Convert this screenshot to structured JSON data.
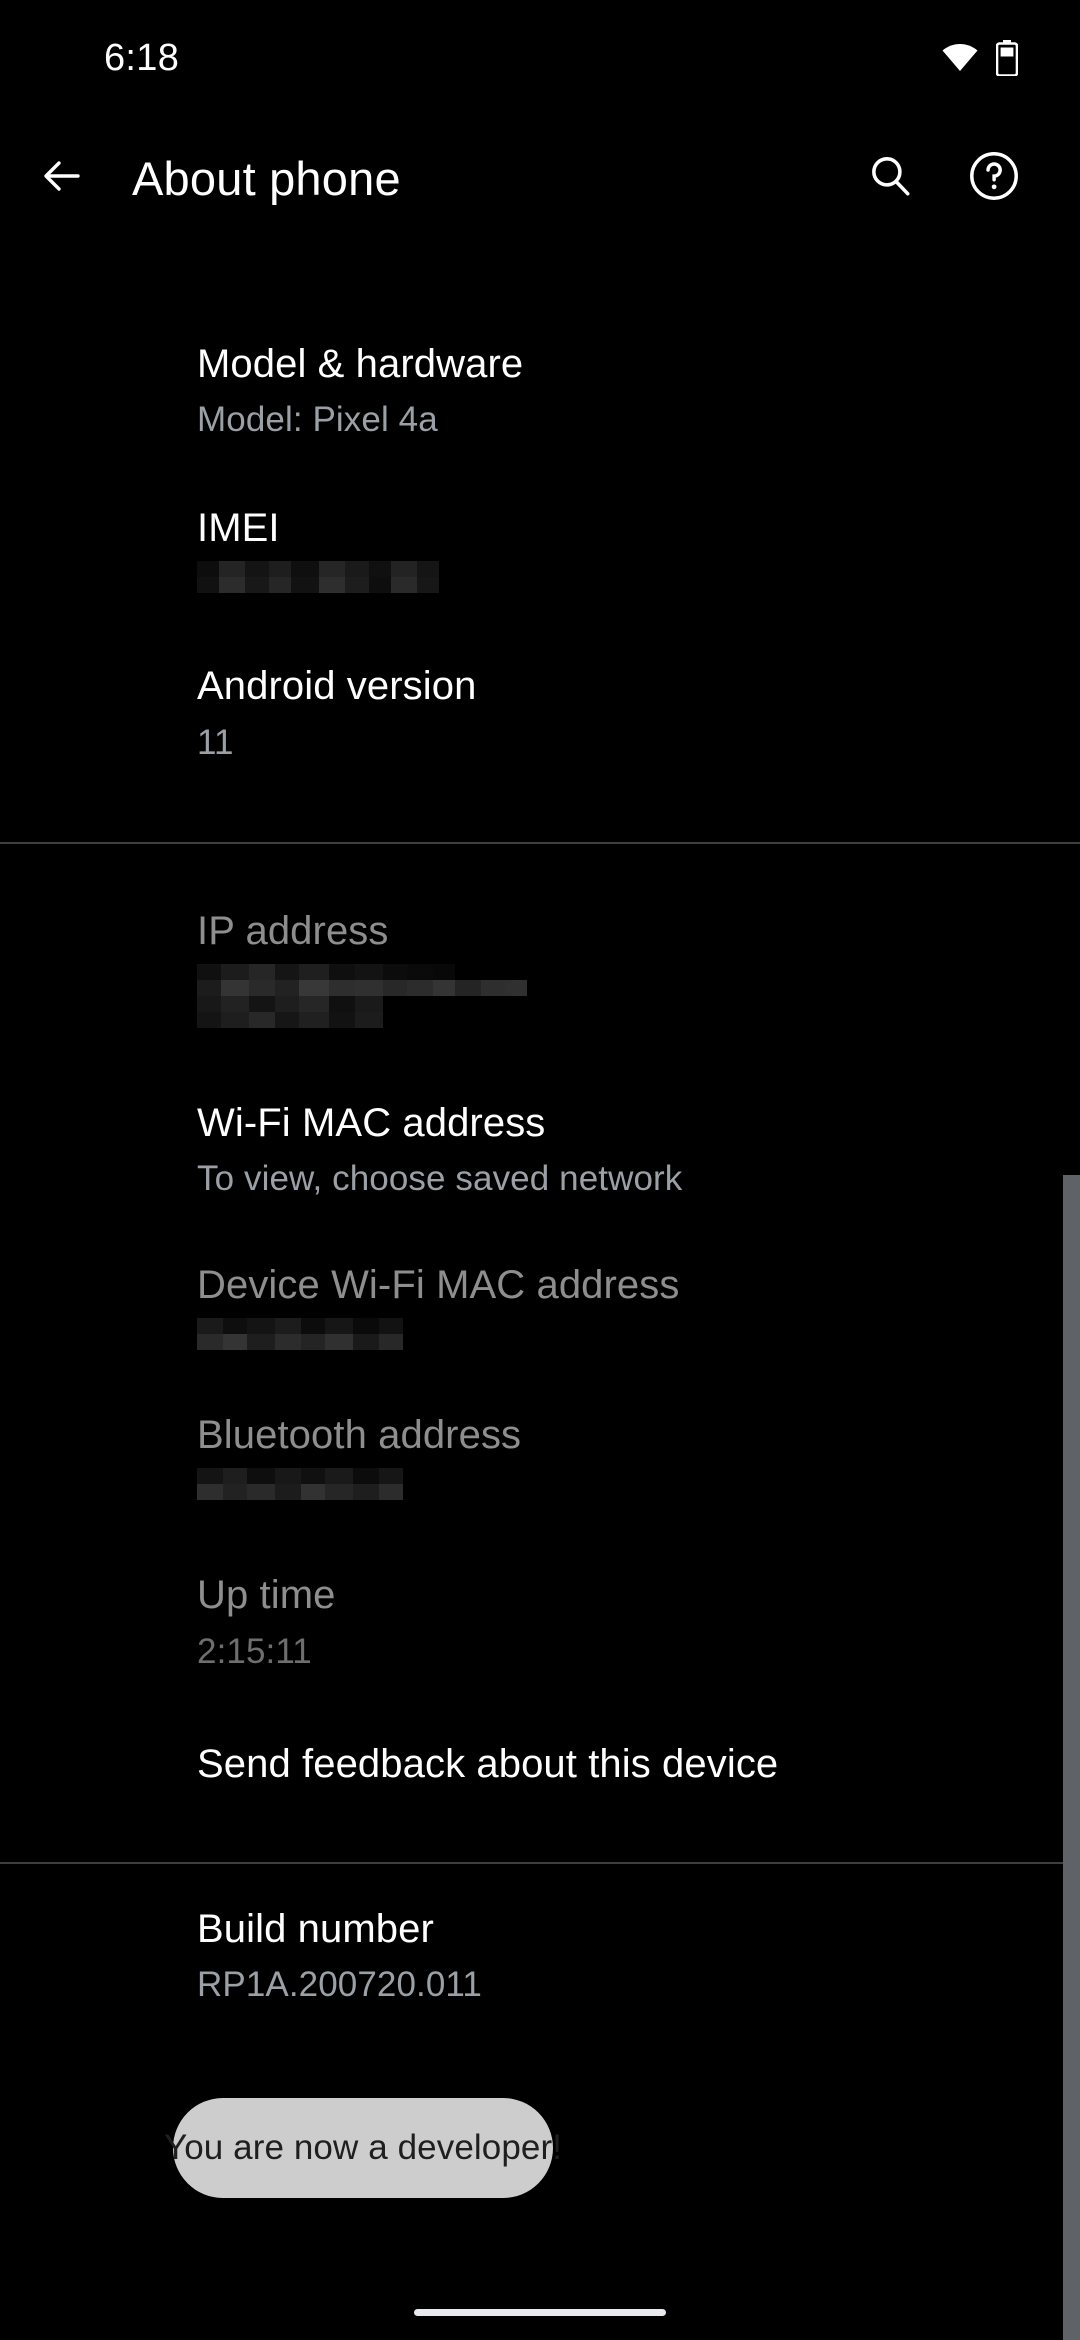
{
  "status_bar": {
    "time": "6:18",
    "wifi_icon": "wifi-icon",
    "battery_icon": "battery-icon"
  },
  "app_bar": {
    "back_icon": "arrow-back-icon",
    "title": "About phone",
    "search_icon": "search-icon",
    "help_icon": "help-circle-icon"
  },
  "settings_rows": [
    {
      "title": "Model & hardware",
      "subtitle": "Model: Pixel 4a",
      "state": "enabled",
      "redacted": false
    },
    {
      "title": "IMEI",
      "subtitle": "",
      "state": "enabled",
      "redacted": true
    },
    {
      "title": "Android version",
      "subtitle": "11",
      "state": "enabled",
      "redacted": false
    },
    {
      "title": "IP address",
      "subtitle": "",
      "state": "disabled",
      "redacted": true
    },
    {
      "title": "Wi-Fi MAC address",
      "subtitle": "To view, choose saved network",
      "state": "enabled",
      "redacted": false
    },
    {
      "title": "Device Wi-Fi MAC address",
      "subtitle": "",
      "state": "disabled",
      "redacted": true
    },
    {
      "title": "Bluetooth address",
      "subtitle": "",
      "state": "disabled",
      "redacted": true
    },
    {
      "title": "Up time",
      "subtitle": "2:15:11",
      "state": "disabled",
      "redacted": false
    },
    {
      "title": "Send feedback about this device",
      "subtitle": "",
      "state": "enabled",
      "redacted": false
    },
    {
      "title": "Build number",
      "subtitle": "RP1A.200720.011",
      "state": "enabled",
      "redacted": false
    }
  ],
  "toast": {
    "message": "You are now a developer!",
    "background_color": "#dedede",
    "text_color": "#1f1f1f"
  },
  "colors": {
    "background": "#000000",
    "text_primary": "#ffffff",
    "text_secondary": "#9aa0a6",
    "text_disabled": "#8e8e8e",
    "divider": "#3c4043",
    "scrollbar": "#5f6368"
  },
  "home_indicator": "home-indicator"
}
